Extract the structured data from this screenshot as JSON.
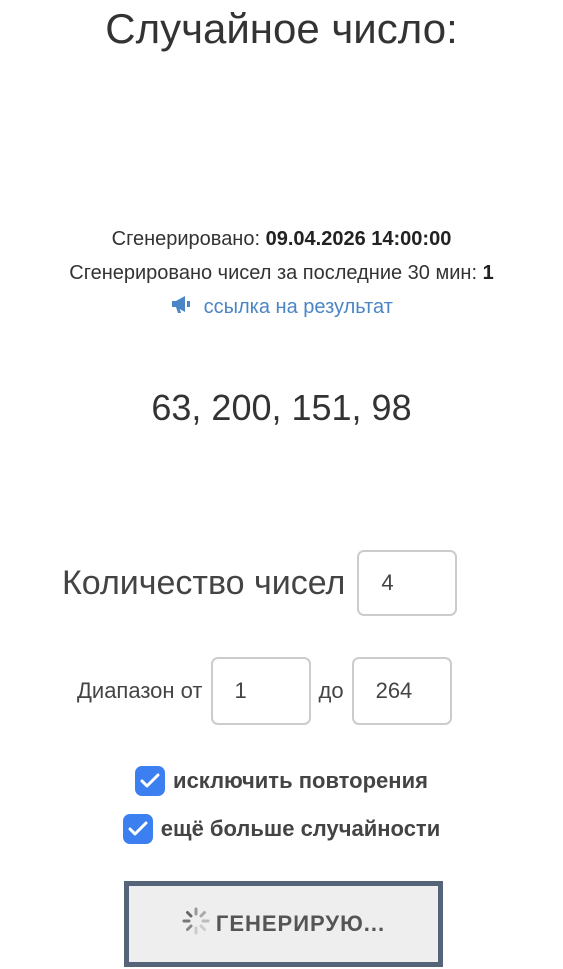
{
  "header": {
    "title": "Случайное число:"
  },
  "info": {
    "generated_label": "Сгенерировано:",
    "generated_value": "09.04.2026 14:00:00",
    "count_label": "Сгенерировано чисел за последние 30 мин:",
    "count_value": "1",
    "link_text": "ссылка на результат",
    "link_icon": "megaphone-icon"
  },
  "result": {
    "numbers": "63, 200, 151, 98"
  },
  "form": {
    "quantity_label": "Количество чисел",
    "quantity_value": "4",
    "range_from_label": "Диапазон от",
    "range_from_value": "1",
    "range_to_label": "до",
    "range_to_value": "264",
    "exclude_repeats_label": "исключить повторения",
    "exclude_repeats_checked": true,
    "more_random_label": "ещё больше случайности",
    "more_random_checked": true,
    "generate_button_label": "ГЕНЕРИРУЮ..."
  },
  "colors": {
    "accent": "#3b7ff0",
    "link": "#4a86c5",
    "button_border": "#56647a"
  }
}
